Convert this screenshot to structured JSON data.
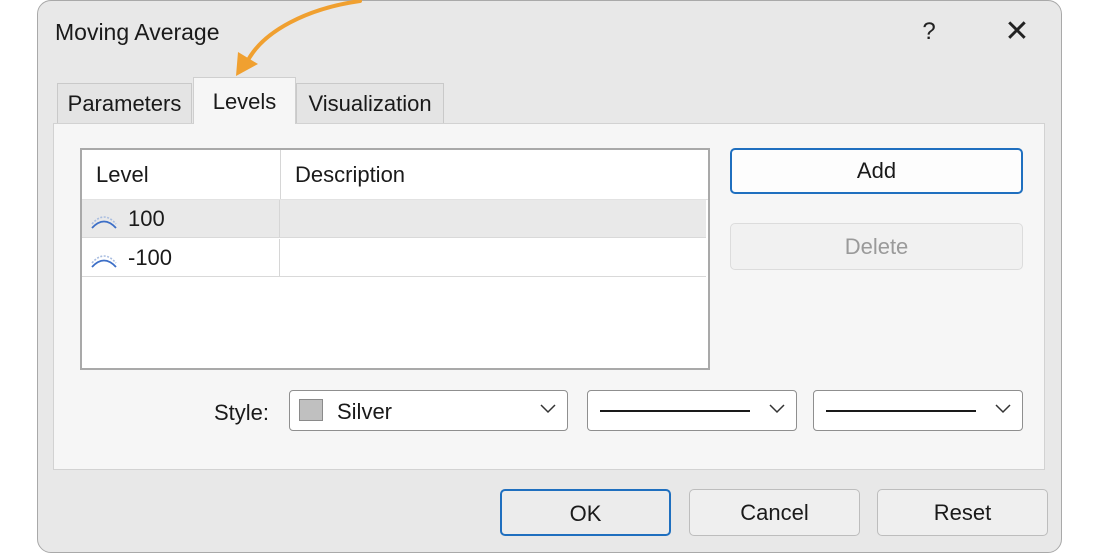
{
  "window": {
    "title": "Moving Average",
    "help_label": "?",
    "close_label": "✕"
  },
  "tabs": [
    {
      "label": "Parameters",
      "active": false
    },
    {
      "label": "Levels",
      "active": true
    },
    {
      "label": "Visualization",
      "active": false
    }
  ],
  "levels_table": {
    "columns": [
      "Level",
      "Description"
    ],
    "rows": [
      {
        "level": "100",
        "description": "",
        "selected": true,
        "icon": "level-line-icon"
      },
      {
        "level": "-100",
        "description": "",
        "selected": false,
        "icon": "level-line-icon"
      }
    ]
  },
  "actions": {
    "add_label": "Add",
    "delete_label": "Delete"
  },
  "style": {
    "label": "Style:",
    "color_name": "Silver",
    "color_hex": "#C0C0C0",
    "line_style": "solid",
    "line_width": "thin"
  },
  "footer": {
    "ok_label": "OK",
    "cancel_label": "Cancel",
    "reset_label": "Reset"
  },
  "colors": {
    "accent": "#1F6FBF",
    "annotation_arrow": "#F0A030"
  }
}
